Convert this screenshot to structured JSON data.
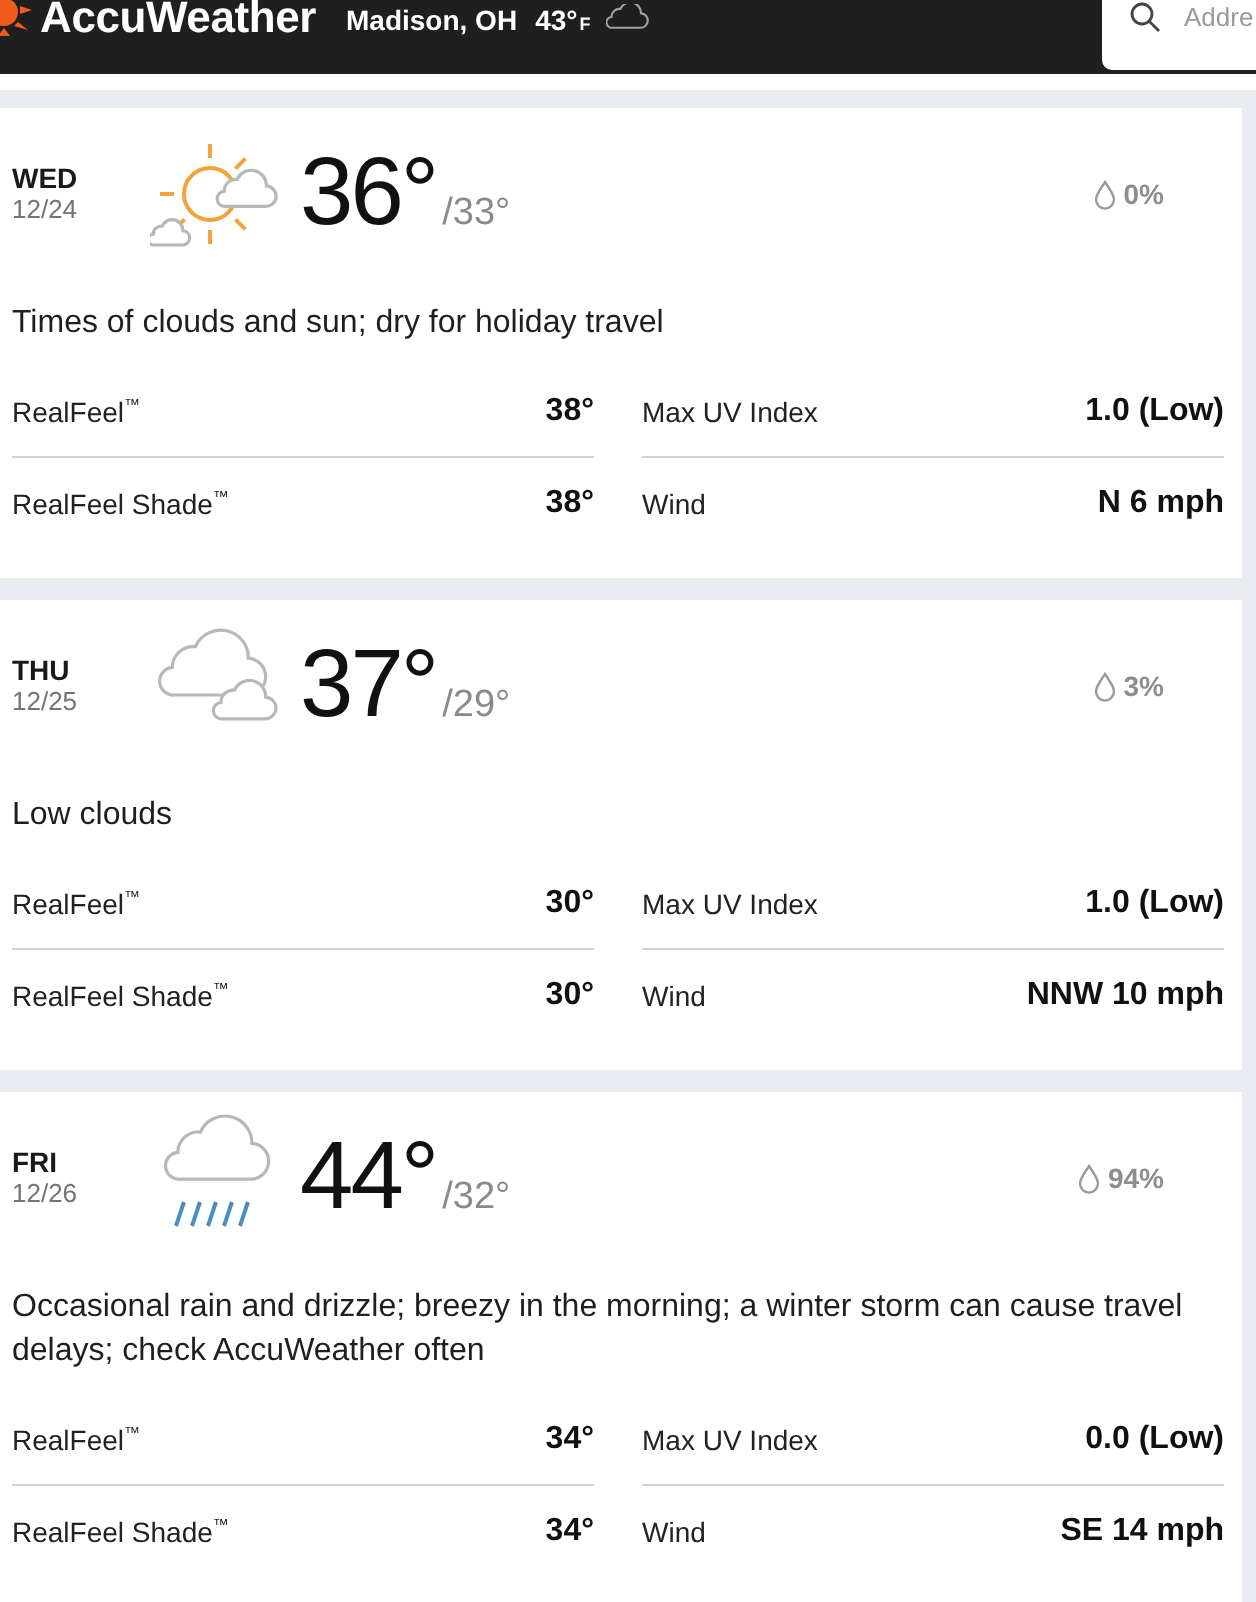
{
  "header": {
    "brand": "AccuWeather",
    "location": "Madison, OH",
    "temperature": "43°$_{F}$"
  },
  "search": {
    "placeholder": "Addre"
  },
  "days": [
    {
      "kind": "partly-sunny",
      "day": "WED",
      "date": "12/24",
      "high": "36°",
      "low": "/33°",
      "precipitation": "0%",
      "phrase": "Times of clouds and sun; dry for holiday travel",
      "details": [
        {
          "label": "RealFeel$^{™}$",
          "value": "38°"
        },
        {
          "label": "Max UV Index",
          "value": "1.0 (Low)"
        },
        {
          "label": "RealFeel Shade$^{™}$",
          "value": "38°"
        },
        {
          "label": "Wind",
          "value": "N 6 mph"
        }
      ]
    },
    {
      "kind": "cloudy",
      "day": "THU",
      "date": "12/25",
      "high": "37°",
      "low": "/29°",
      "precipitation": "3%",
      "phrase": "Low clouds",
      "details": [
        {
          "label": "RealFeel$^{™}$",
          "value": "30°"
        },
        {
          "label": "Max UV Index",
          "value": "1.0 (Low)"
        },
        {
          "label": "RealFeel Shade$^{™}$",
          "value": "30°"
        },
        {
          "label": "Wind",
          "value": "NNW 10 mph"
        }
      ]
    },
    {
      "kind": "rain",
      "day": "FRI",
      "date": "12/26",
      "high": "44°",
      "low": "/32°",
      "precipitation": "94%",
      "phrase": "Occasional rain and drizzle; breezy in the morning; a winter storm can cause travel delays; check AccuWeather often",
      "details": [
        {
          "label": "RealFeel$^{™}$",
          "value": "34°"
        },
        {
          "label": "Max UV Index",
          "value": "0.0 (Low)"
        },
        {
          "label": "RealFeel Shade$^{™}$",
          "value": "34°"
        },
        {
          "label": "Wind",
          "value": "SE 14 mph"
        }
      ]
    }
  ]
}
